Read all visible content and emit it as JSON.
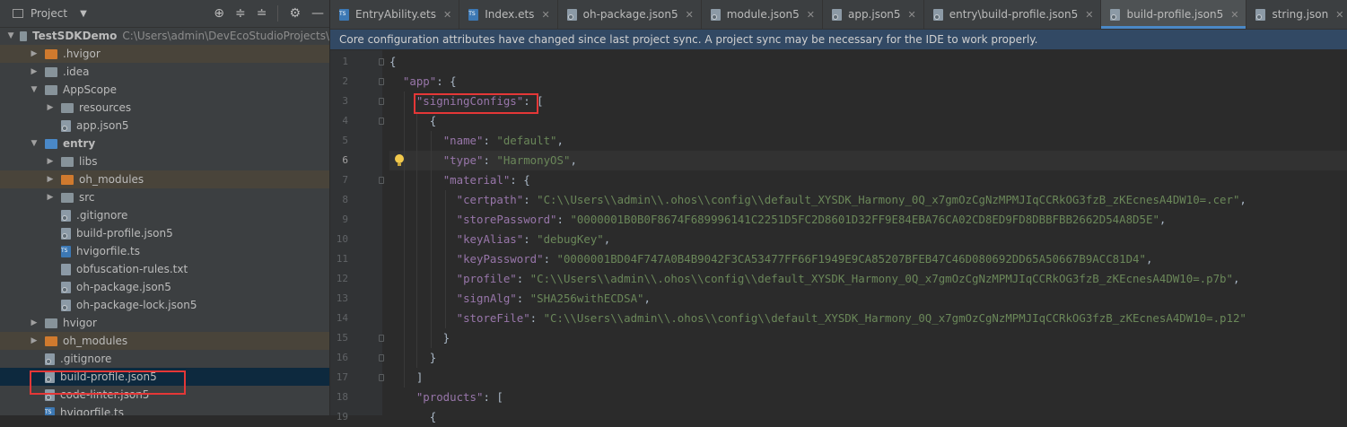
{
  "project_panel": {
    "title": "Project",
    "dropdown_icon": "chevron-down-icon",
    "toolbar_icons": [
      "crosshair-icon",
      "expand-all-icon",
      "collapse-all-icon",
      "gear-icon",
      "minimize-icon"
    ],
    "tree": [
      {
        "label": "TestSDKDemo",
        "hint": "C:\\Users\\admin\\DevEcoStudioProjects\\",
        "depth": 0,
        "expanded": true,
        "kind": "folder-gray",
        "bold": true
      },
      {
        "label": ".hvigor",
        "depth": 1,
        "expanded": false,
        "kind": "folder-orange",
        "highlight": true
      },
      {
        "label": ".idea",
        "depth": 1,
        "expanded": false,
        "kind": "folder-gray"
      },
      {
        "label": "AppScope",
        "depth": 1,
        "expanded": true,
        "kind": "folder-gray"
      },
      {
        "label": "resources",
        "depth": 2,
        "expanded": false,
        "kind": "folder-gray"
      },
      {
        "label": "app.json5",
        "depth": 2,
        "kind": "file-gear"
      },
      {
        "label": "entry",
        "depth": 1,
        "expanded": true,
        "kind": "folder-blue",
        "bold": true
      },
      {
        "label": "libs",
        "depth": 2,
        "expanded": false,
        "kind": "folder-gray"
      },
      {
        "label": "oh_modules",
        "depth": 2,
        "expanded": false,
        "kind": "folder-orange",
        "highlight": true
      },
      {
        "label": "src",
        "depth": 2,
        "expanded": false,
        "kind": "folder-gray"
      },
      {
        "label": ".gitignore",
        "depth": 2,
        "kind": "file-gear"
      },
      {
        "label": "build-profile.json5",
        "depth": 2,
        "kind": "file-gear"
      },
      {
        "label": "hvigorfile.ts",
        "depth": 2,
        "kind": "file-ts"
      },
      {
        "label": "obfuscation-rules.txt",
        "depth": 2,
        "kind": "file"
      },
      {
        "label": "oh-package.json5",
        "depth": 2,
        "kind": "file-gear"
      },
      {
        "label": "oh-package-lock.json5",
        "depth": 2,
        "kind": "file-gear"
      },
      {
        "label": "hvigor",
        "depth": 1,
        "expanded": false,
        "kind": "folder-gray"
      },
      {
        "label": "oh_modules",
        "depth": 1,
        "expanded": false,
        "kind": "folder-orange",
        "highlight": true
      },
      {
        "label": ".gitignore",
        "depth": 1,
        "kind": "file-gear"
      },
      {
        "label": "build-profile.json5",
        "depth": 1,
        "kind": "file-gear",
        "selected": true
      },
      {
        "label": "code-linter.json5",
        "depth": 1,
        "kind": "file-gear"
      },
      {
        "label": "hvigorfile.ts",
        "depth": 1,
        "kind": "file-ts"
      }
    ]
  },
  "tabs": [
    {
      "label": "EntryAbility.ets",
      "icon": "ts"
    },
    {
      "label": "Index.ets",
      "icon": "ts"
    },
    {
      "label": "oh-package.json5",
      "icon": "gear"
    },
    {
      "label": "module.json5",
      "icon": "gear"
    },
    {
      "label": "app.json5",
      "icon": "gear"
    },
    {
      "label": "entry\\build-profile.json5",
      "icon": "gear"
    },
    {
      "label": "build-profile.json5",
      "icon": "gear",
      "active": true
    },
    {
      "label": "string.json",
      "icon": "gear"
    }
  ],
  "notice": "Core configuration attributes have changed since last project sync. A project sync may be necessary for the IDE to work properly.",
  "editor": {
    "current_line": 6,
    "lines": [
      {
        "n": "1",
        "parts": [
          [
            "p",
            "{"
          ]
        ]
      },
      {
        "n": "2",
        "parts": [
          [
            "p",
            "  "
          ],
          [
            "k",
            "\"app\""
          ],
          [
            "p",
            ": {"
          ]
        ]
      },
      {
        "n": "3",
        "parts": [
          [
            "p",
            "    "
          ],
          [
            "k",
            "\"signingConfigs\""
          ],
          [
            "p",
            ": ["
          ]
        ]
      },
      {
        "n": "4",
        "parts": [
          [
            "p",
            "      {"
          ]
        ]
      },
      {
        "n": "5",
        "parts": [
          [
            "p",
            "        "
          ],
          [
            "k",
            "\"name\""
          ],
          [
            "p",
            ": "
          ],
          [
            "s",
            "\"default\""
          ],
          [
            "p",
            ","
          ]
        ]
      },
      {
        "n": "6",
        "parts": [
          [
            "p",
            "        "
          ],
          [
            "k",
            "\"type\""
          ],
          [
            "p",
            ": "
          ],
          [
            "s",
            "\"HarmonyOS\""
          ],
          [
            "p",
            ","
          ]
        ]
      },
      {
        "n": "7",
        "parts": [
          [
            "p",
            "        "
          ],
          [
            "k",
            "\"material\""
          ],
          [
            "p",
            ": {"
          ]
        ]
      },
      {
        "n": "8",
        "parts": [
          [
            "p",
            "          "
          ],
          [
            "k",
            "\"certpath\""
          ],
          [
            "p",
            ": "
          ],
          [
            "s",
            "\"C:\\\\Users\\\\admin\\\\.ohos\\\\config\\\\default_XYSDK_Harmony_0Q_x7gmOzCgNzMPMJIqCCRkOG3fzB_zKEcnesA4DW10=.cer\""
          ],
          [
            "p",
            ","
          ]
        ]
      },
      {
        "n": "9",
        "parts": [
          [
            "p",
            "          "
          ],
          [
            "k",
            "\"storePassword\""
          ],
          [
            "p",
            ": "
          ],
          [
            "s",
            "\"0000001B0B0F8674F689996141C2251D5FC2D8601D32FF9E84EBA76CA02CD8ED9FD8DBBFBB2662D54A8D5E\""
          ],
          [
            "p",
            ","
          ]
        ]
      },
      {
        "n": "10",
        "parts": [
          [
            "p",
            "          "
          ],
          [
            "k",
            "\"keyAlias\""
          ],
          [
            "p",
            ": "
          ],
          [
            "s",
            "\"debugKey\""
          ],
          [
            "p",
            ","
          ]
        ]
      },
      {
        "n": "11",
        "parts": [
          [
            "p",
            "          "
          ],
          [
            "k",
            "\"keyPassword\""
          ],
          [
            "p",
            ": "
          ],
          [
            "s",
            "\"0000001BD04F747A0B4B9042F3CA53477FF66F1949E9CA85207BFEB47C46D080692DD65A50667B9ACC81D4\""
          ],
          [
            "p",
            ","
          ]
        ]
      },
      {
        "n": "12",
        "parts": [
          [
            "p",
            "          "
          ],
          [
            "k",
            "\"profile\""
          ],
          [
            "p",
            ": "
          ],
          [
            "s",
            "\"C:\\\\Users\\\\admin\\\\.ohos\\\\config\\\\default_XYSDK_Harmony_0Q_x7gmOzCgNzMPMJIqCCRkOG3fzB_zKEcnesA4DW10=.p7b\""
          ],
          [
            "p",
            ","
          ]
        ]
      },
      {
        "n": "13",
        "parts": [
          [
            "p",
            "          "
          ],
          [
            "k",
            "\"signAlg\""
          ],
          [
            "p",
            ": "
          ],
          [
            "s",
            "\"SHA256withECDSA\""
          ],
          [
            "p",
            ","
          ]
        ]
      },
      {
        "n": "14",
        "parts": [
          [
            "p",
            "          "
          ],
          [
            "k",
            "\"storeFile\""
          ],
          [
            "p",
            ": "
          ],
          [
            "s",
            "\"C:\\\\Users\\\\admin\\\\.ohos\\\\config\\\\default_XYSDK_Harmony_0Q_x7gmOzCgNzMPMJIqCCRkOG3fzB_zKEcnesA4DW10=.p12\""
          ]
        ]
      },
      {
        "n": "15",
        "parts": [
          [
            "p",
            "        }"
          ]
        ]
      },
      {
        "n": "16",
        "parts": [
          [
            "p",
            "      }"
          ]
        ]
      },
      {
        "n": "17",
        "parts": [
          [
            "p",
            "    ]"
          ]
        ]
      },
      {
        "n": "18",
        "parts": [
          [
            "p",
            "    "
          ],
          [
            "k",
            "\"products\""
          ],
          [
            "p",
            ": ["
          ]
        ]
      },
      {
        "n": "19",
        "parts": [
          [
            "p",
            "      {"
          ]
        ]
      }
    ]
  },
  "colors": {
    "accent": "#4a88c7",
    "annotation_red": "#e43737",
    "json_key": "#9876aa",
    "json_string": "#6a8759"
  }
}
